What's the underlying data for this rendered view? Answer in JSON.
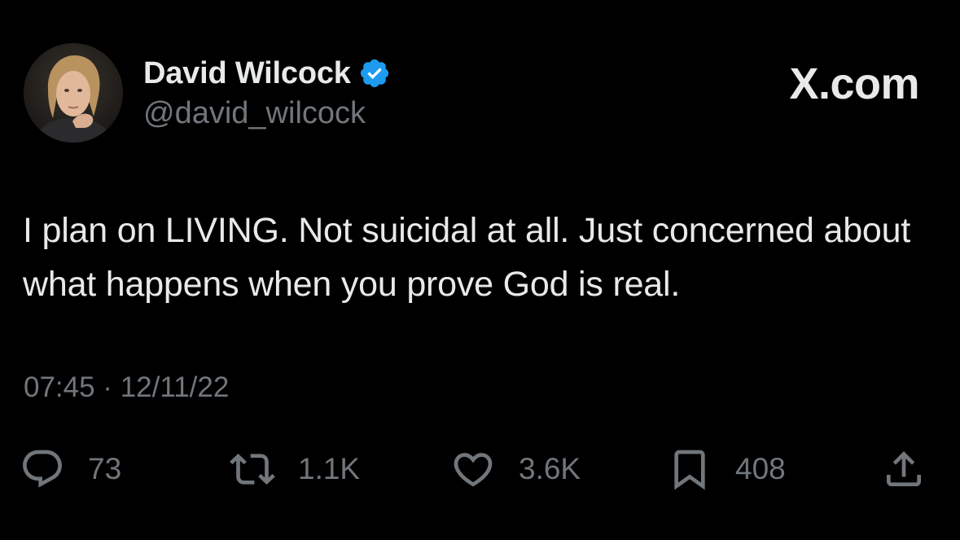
{
  "author": {
    "display_name": "David Wilcock",
    "handle": "@david_wilcock",
    "verified": true,
    "avatar_icon": "profile-photo"
  },
  "brand": {
    "label": "X.com"
  },
  "tweet": {
    "text": "I plan on LIVING. Not suicidal at all. Just concerned about what happens when you prove God is real.",
    "timestamp": "07:45 · 12/11/22"
  },
  "actions": {
    "reply": {
      "icon": "reply-icon",
      "count": "73"
    },
    "retweet": {
      "icon": "retweet-icon",
      "count": "1.1K"
    },
    "like": {
      "icon": "heart-icon",
      "count": "3.6K"
    },
    "bookmark": {
      "icon": "bookmark-icon",
      "count": "408"
    },
    "share": {
      "icon": "share-icon"
    }
  },
  "colors": {
    "background": "#000000",
    "primary_text": "#e7e9ea",
    "secondary_text": "#71767b",
    "verified_badge": "#1d9bf0"
  }
}
